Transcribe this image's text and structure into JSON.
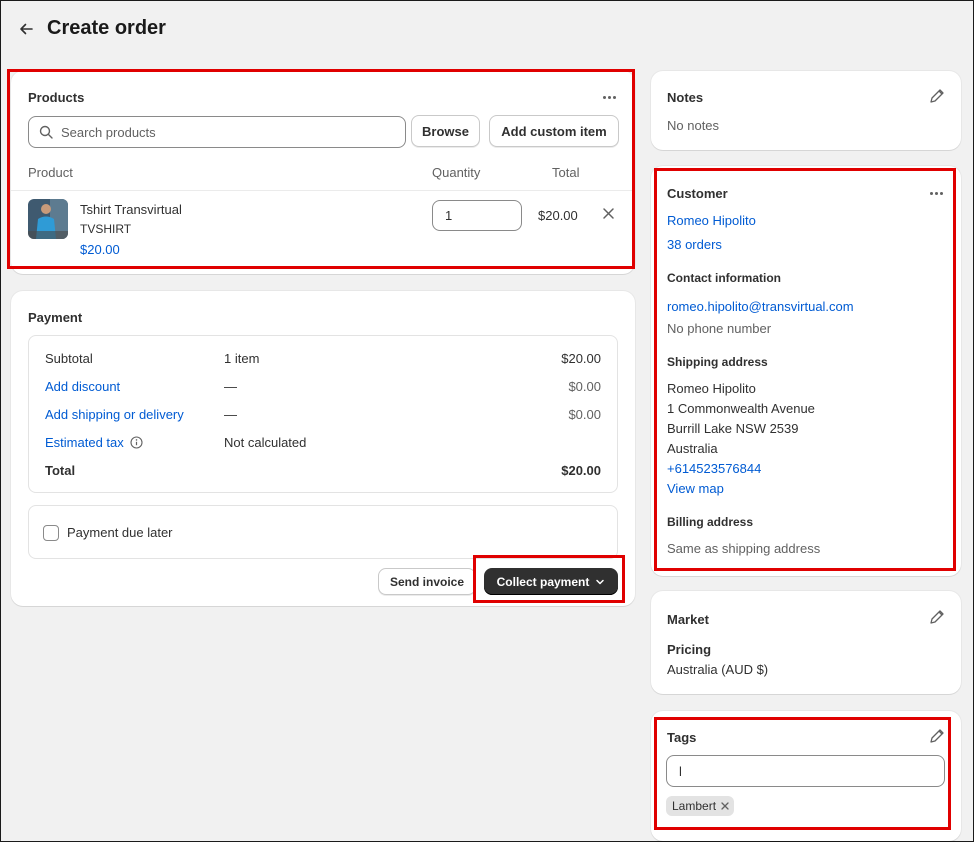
{
  "header": {
    "title": "Create order"
  },
  "products": {
    "title": "Products",
    "search_placeholder": "Search products",
    "browse_label": "Browse",
    "add_custom_label": "Add custom item",
    "columns": {
      "product": "Product",
      "quantity": "Quantity",
      "total": "Total"
    },
    "items": [
      {
        "name": "Tshirt Transvirtual",
        "sku": "TVSHIRT",
        "price": "$20.00",
        "quantity": "1",
        "total": "$20.00"
      }
    ]
  },
  "payment": {
    "title": "Payment",
    "rows": {
      "subtotal": {
        "label": "Subtotal",
        "detail": "1 item",
        "amount": "$20.00"
      },
      "discount": {
        "label": "Add discount",
        "detail": "—",
        "amount": "$0.00"
      },
      "shipping": {
        "label": "Add shipping or delivery",
        "detail": "—",
        "amount": "$0.00"
      },
      "tax": {
        "label": "Estimated tax",
        "detail": "Not calculated"
      },
      "total": {
        "label": "Total",
        "amount": "$20.00"
      }
    },
    "due_later_label": "Payment due later",
    "send_invoice_label": "Send invoice",
    "collect_payment_label": "Collect payment"
  },
  "notes": {
    "title": "Notes",
    "text": "No notes"
  },
  "customer": {
    "title": "Customer",
    "name": "Romeo Hipolito",
    "orders": "38 orders",
    "contact_title": "Contact information",
    "email": "romeo.hipolito@transvirtual.com",
    "phone": "No phone number",
    "shipping_title": "Shipping address",
    "shipping_lines": [
      "Romeo Hipolito",
      "1 Commonwealth Avenue",
      "Burrill Lake NSW 2539",
      "Australia"
    ],
    "shipping_phone": "+614523576844",
    "view_map": "View map",
    "billing_title": "Billing address",
    "billing_text": "Same as shipping address"
  },
  "market": {
    "title": "Market",
    "pricing_label": "Pricing",
    "pricing_value": "Australia (AUD $)"
  },
  "tags": {
    "title": "Tags",
    "input_value": "l",
    "chips": [
      "Lambert"
    ]
  },
  "colors": {
    "highlight": "#e00000",
    "link": "#005bd3",
    "primary_button": "#303030"
  }
}
